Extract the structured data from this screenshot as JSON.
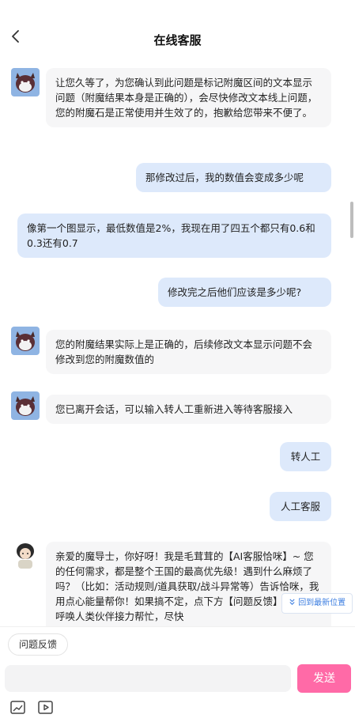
{
  "header": {
    "title": "在线客服"
  },
  "messages": [
    {
      "side": "left",
      "avatar": "bot",
      "text": "让您久等了，为您确认到此问题是标记附魔区间的文本显示问题（附魔结果本身是正确的），会尽快修改文本线上问题，您的附魔石是正常使用并生效了的，抱歉给您带来不便了。"
    },
    {
      "side": "right",
      "text": "那修改过后，我的数值会变成多少呢"
    },
    {
      "side": "right",
      "text": "像第一个图显示，最低数值是2%，我现在用了四五个都只有0.6和0.3还有0.7"
    },
    {
      "side": "right",
      "text": "修改完之后他们应该是多少呢?"
    },
    {
      "side": "left",
      "avatar": "bot",
      "text": "您的附魔结果实际上是正确的，后续修改文本显示问题不会修改到您的附魔数值的"
    },
    {
      "side": "left",
      "avatar": "bot",
      "text": "您已离开会话，可以输入转人工重新进入等待客服接入"
    },
    {
      "side": "right",
      "text": "转人工"
    },
    {
      "side": "right",
      "text": "人工客服"
    },
    {
      "side": "left",
      "avatar": "agent",
      "text": "亲爱的魔导士，你好呀！我是毛茸茸的【AI客服恰咪】~ 您的任何需求，都是整个王国的最高优先级！遇到什么麻烦了吗？（比如：活动规则/道具获取/战斗异常等）告诉恰咪，我用点心能量帮你！如果搞不定，点下方【问题反馈】恰咪会呼唤人类伙伴接力帮忙，尽快"
    }
  ],
  "back_to_latest": "回到最新位置",
  "bottom": {
    "feedback_label": "问题反馈",
    "input_value": "",
    "input_placeholder": "",
    "send_label": "发送"
  },
  "icons": {
    "back": "chevron-left-icon",
    "image": "image-upload-icon",
    "video": "video-upload-icon",
    "back_to_latest": "double-chevron-down-icon"
  },
  "colors": {
    "send_button": "#ff6aa7",
    "user_bubble": "#dde9fb",
    "bot_bubble": "#f6f6f7",
    "link_blue": "#3b7de0"
  }
}
